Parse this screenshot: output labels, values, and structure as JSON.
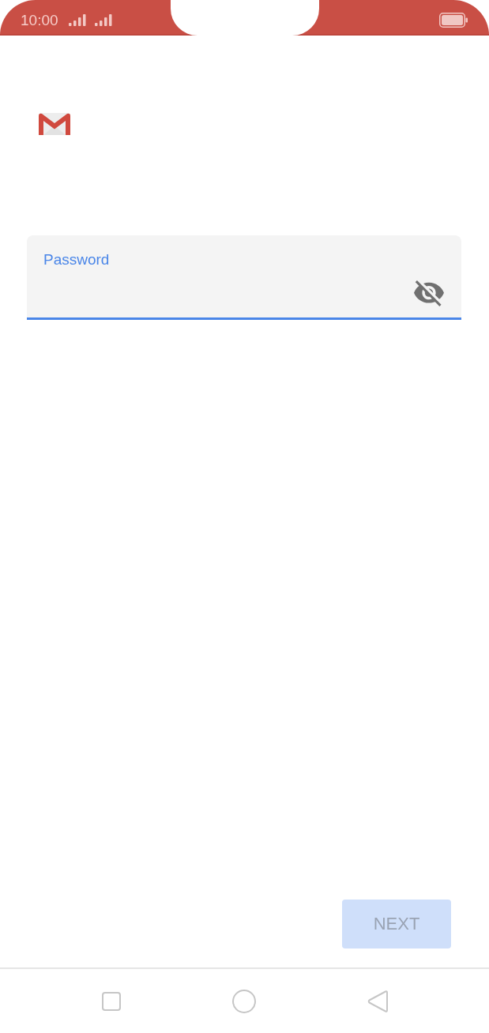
{
  "status_bar": {
    "time": "10:00"
  },
  "password_field": {
    "label": "Password",
    "focused": true,
    "password_visible": false
  },
  "next_button": {
    "label": "NEXT",
    "disabled": true
  }
}
